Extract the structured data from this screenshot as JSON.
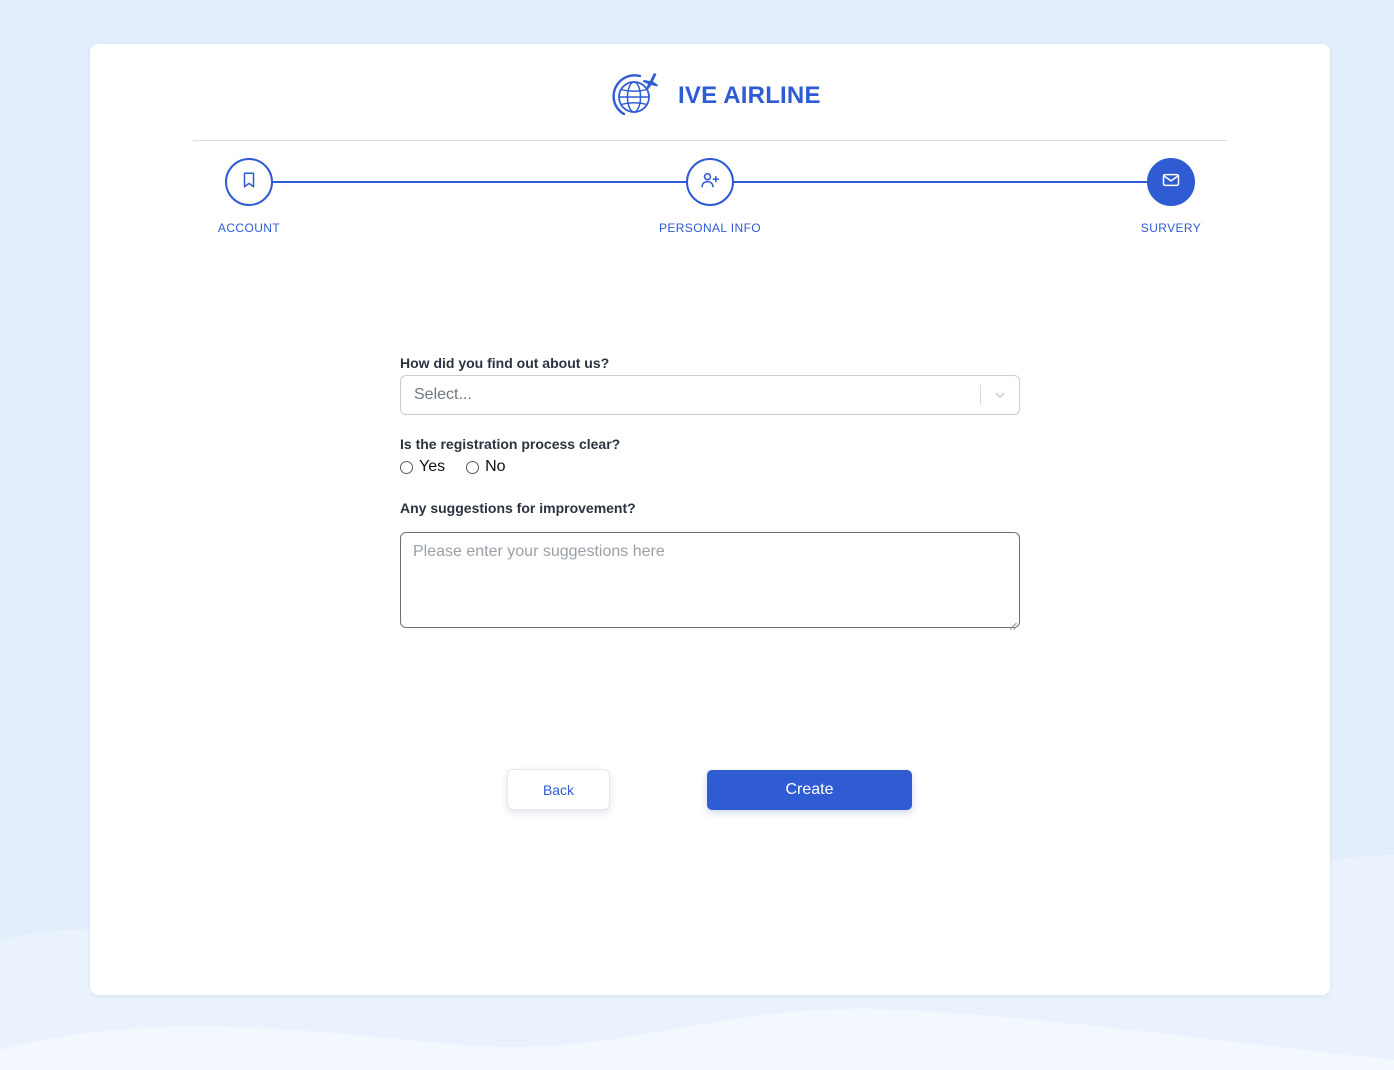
{
  "brand": {
    "name": "IVE AIRLINE",
    "logo_icon": "globe-airplane-icon",
    "color": "#2f5bd3"
  },
  "stepper": {
    "steps": [
      {
        "label": "ACCOUNT",
        "icon": "bookmark-icon",
        "state": "completed"
      },
      {
        "label": "PERSONAL INFO",
        "icon": "user-plus-icon",
        "state": "completed"
      },
      {
        "label": "SURVERY",
        "icon": "mail-icon",
        "state": "active"
      }
    ]
  },
  "survey": {
    "source_question": "How did you find out about us?",
    "source_select": {
      "value": "Select..."
    },
    "clarity_question": "Is the registration process clear?",
    "clarity_options": [
      {
        "label": "Yes",
        "checked": false
      },
      {
        "label": "No",
        "checked": false
      }
    ],
    "suggestions_question": "Any suggestions for improvement?",
    "suggestions_input": {
      "value": "",
      "placeholder": "Please enter your suggestions here"
    }
  },
  "actions": {
    "back_label": "Back",
    "create_label": "Create"
  },
  "colors": {
    "accent": "#2f5bd3",
    "page_background": "#e2eefc",
    "card_background": "#ffffff"
  }
}
